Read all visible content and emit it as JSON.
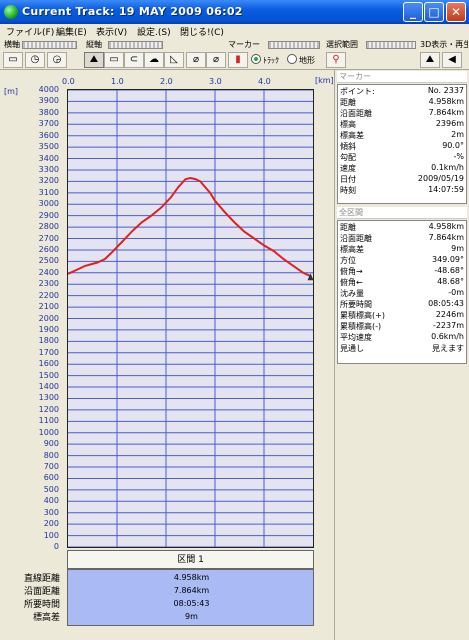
{
  "window": {
    "title": "Current Track: 19 MAY 2009 06:02",
    "min": "_",
    "max": "□",
    "close": "✕"
  },
  "menu": [
    "ファイル(F)",
    "編集(E)",
    "表示(V)",
    "設定.(S)",
    "閉じる!(C)"
  ],
  "toolbar": {
    "horizontal_label": "横軸",
    "vertical_label": "縦軸",
    "marker_label": "マーカー",
    "range_label": "選択範囲",
    "view3d_label": "3D表示・再生",
    "track_label": "ﾄﾗｯｸ",
    "terrain_label": "地形",
    "track_selected": true
  },
  "graph": {
    "unit": "[m]",
    "xunit": "[km]"
  },
  "chart_data": {
    "type": "line",
    "xlabel": "[km]",
    "ylabel": "[m]",
    "xlim": [
      0,
      5.0
    ],
    "ylim": [
      0,
      4000
    ],
    "xticks": [
      "0.0",
      "1.0",
      "2.0",
      "3.0",
      "4.0"
    ],
    "yticks": [
      "4000",
      "3900",
      "3800",
      "3700",
      "3600",
      "3500",
      "3400",
      "3300",
      "3200",
      "3100",
      "3000",
      "2900",
      "2800",
      "2700",
      "2600",
      "2500",
      "2400",
      "2300",
      "2200",
      "2100",
      "2000",
      "1900",
      "1800",
      "1700",
      "1600",
      "1500",
      "1400",
      "1300",
      "1200",
      "1100",
      "1000",
      "900",
      "800",
      "700",
      "600",
      "500",
      "400",
      "300",
      "200",
      "100",
      "0"
    ],
    "grid": true,
    "series": [
      {
        "color": "#e02020",
        "x": [
          0.0,
          0.15,
          0.35,
          0.6,
          0.75,
          0.9,
          1.1,
          1.3,
          1.5,
          1.7,
          1.9,
          2.1,
          2.25,
          2.4,
          2.5,
          2.6,
          2.7,
          2.8,
          2.9,
          3.0,
          3.2,
          3.4,
          3.6,
          3.8,
          4.0,
          4.2,
          4.4,
          4.6,
          4.8,
          4.95
        ],
        "y": [
          2390,
          2420,
          2460,
          2490,
          2520,
          2580,
          2670,
          2760,
          2840,
          2900,
          2970,
          3060,
          3150,
          3220,
          3230,
          3220,
          3200,
          3150,
          3100,
          3030,
          2930,
          2840,
          2760,
          2700,
          2640,
          2590,
          2520,
          2460,
          2400,
          2370
        ]
      }
    ]
  },
  "summary": {
    "header": "区間 1",
    "labels": [
      "直線距離",
      "沿面距離",
      "所要時間",
      "標高差"
    ],
    "values": [
      "4.958km",
      "7.864km",
      "08:05:43",
      "9m"
    ]
  },
  "marker": {
    "title": "マーカー",
    "rows": [
      [
        "ポイント:",
        "No. 2337"
      ],
      [
        "距離",
        "4.958km"
      ],
      [
        "沿面距離",
        "7.864km"
      ],
      [
        "標高",
        "2396m"
      ],
      [
        "標高差",
        "2m"
      ],
      [
        "傾斜",
        "90.0°"
      ],
      [
        "勾配",
        "-%"
      ],
      [
        "速度",
        "0.1km/h"
      ],
      [
        "日付",
        "2009/05/19"
      ],
      [
        "時刻",
        "14:07:59"
      ]
    ]
  },
  "section": {
    "title": "全区間",
    "rows": [
      [
        "距離",
        "4.958km"
      ],
      [
        "沿面距離",
        "7.864km"
      ],
      [
        "標高差",
        "9m"
      ],
      [
        "方位",
        "349.09°"
      ],
      [
        "俯角→",
        "-48.68°"
      ],
      [
        "俯角←",
        "48.68°"
      ],
      [
        "沈み量",
        "-0m"
      ],
      [
        "所要時間",
        "08:05:43"
      ],
      [
        "累積標高(+)",
        "2246m"
      ],
      [
        "累積標高(-)",
        "-2237m"
      ],
      [
        "平均速度",
        "0.6km/h"
      ],
      [
        "見通し",
        "見えます"
      ]
    ]
  }
}
